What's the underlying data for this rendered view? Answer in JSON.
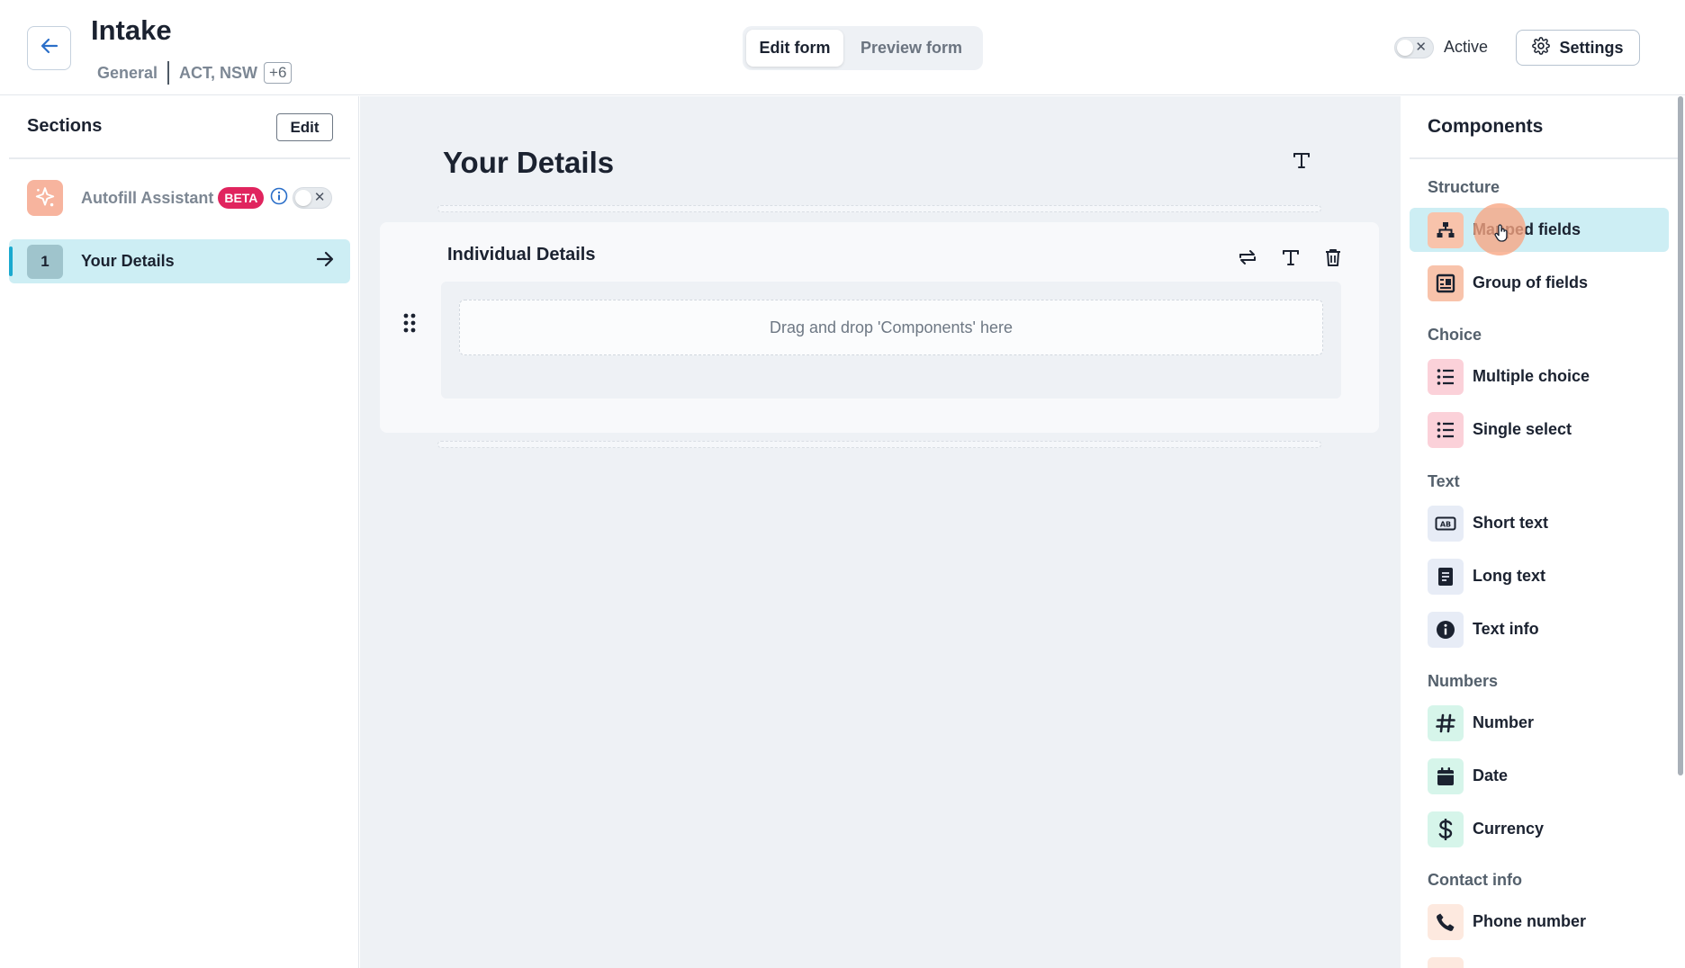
{
  "header": {
    "title": "Intake",
    "category": "General",
    "regions": "ACT, NSW",
    "regions_more": "+6",
    "mode_tabs": [
      {
        "label": "Edit form",
        "active": true
      },
      {
        "label": "Preview form",
        "active": false
      }
    ],
    "active_label": "Active",
    "active_toggle_on": false,
    "settings_label": "Settings"
  },
  "sections_panel": {
    "title": "Sections",
    "edit_label": "Edit",
    "autofill": {
      "label": "Autofill Assistant",
      "badge": "BETA",
      "enabled": false
    },
    "items": [
      {
        "number": "1",
        "label": "Your Details",
        "selected": true
      }
    ]
  },
  "canvas": {
    "section_title": "Your Details",
    "group": {
      "title": "Individual Details",
      "drop_text": "Drag and drop 'Components' here"
    }
  },
  "components_panel": {
    "title": "Components",
    "categories": [
      {
        "label": "Structure",
        "items": [
          {
            "label": "Mapped fields",
            "icon": "sitemap-icon",
            "color": "#f8c3ab",
            "highlighted": true
          },
          {
            "label": "Group of fields",
            "icon": "group-icon",
            "color": "#f8c3ab"
          }
        ]
      },
      {
        "label": "Choice",
        "items": [
          {
            "label": "Multiple choice",
            "icon": "list-icon",
            "color": "#fbd1d9"
          },
          {
            "label": "Single select",
            "icon": "list-icon",
            "color": "#fbd1d9"
          }
        ]
      },
      {
        "label": "Text",
        "items": [
          {
            "label": "Short text",
            "icon": "short-text-icon",
            "color": "#e7ecf6"
          },
          {
            "label": "Long text",
            "icon": "document-icon",
            "color": "#e7ecf6"
          },
          {
            "label": "Text info",
            "icon": "info-icon",
            "color": "#e7ecf6"
          }
        ]
      },
      {
        "label": "Numbers",
        "items": [
          {
            "label": "Number",
            "icon": "hash-icon",
            "color": "#d6f5ea"
          },
          {
            "label": "Date",
            "icon": "calendar-icon",
            "color": "#d6f5ea"
          },
          {
            "label": "Currency",
            "icon": "dollar-icon",
            "color": "#d6f5ea"
          }
        ]
      },
      {
        "label": "Contact info",
        "items": [
          {
            "label": "Phone number",
            "icon": "phone-icon",
            "color": "#fde9df"
          }
        ]
      }
    ]
  },
  "colors": {
    "accent": "#1aa9cf",
    "selected_bg": "#cdeef4",
    "beta_badge": "#e0245e",
    "canvas_bg": "#eef1f5"
  }
}
